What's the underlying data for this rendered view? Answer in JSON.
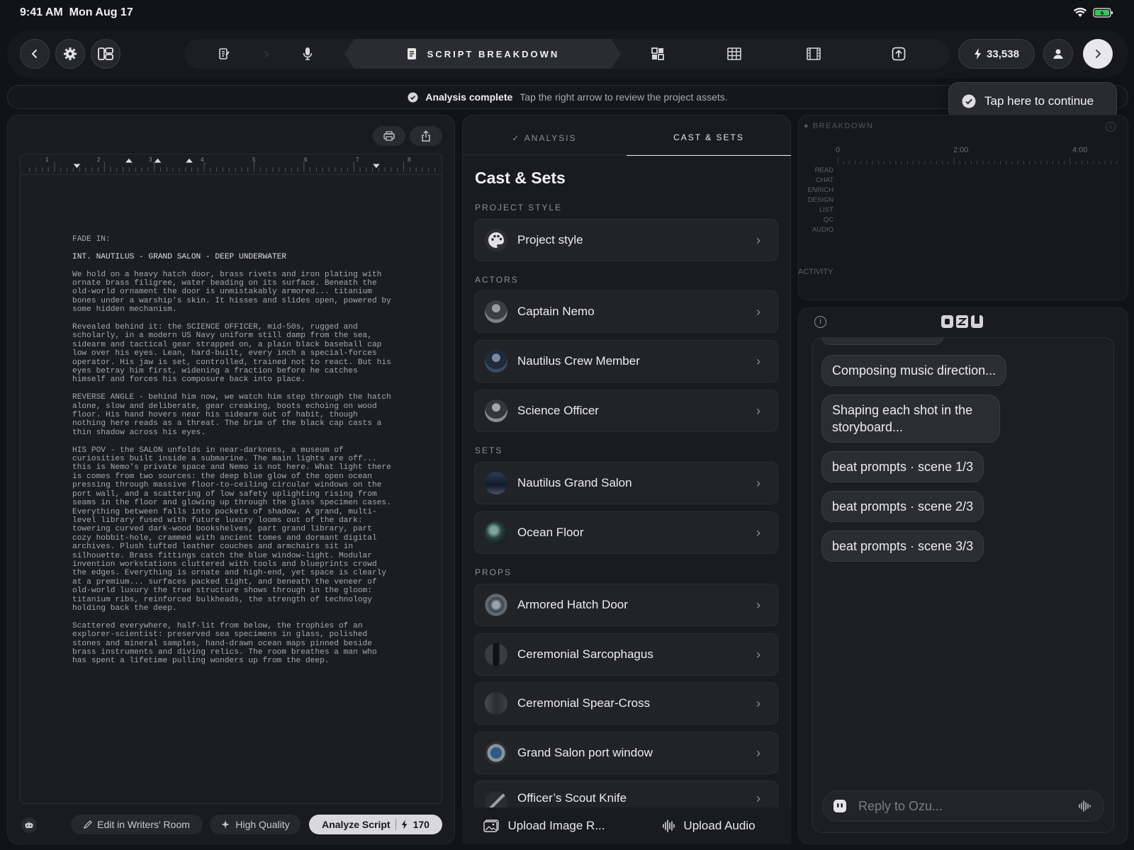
{
  "status": {
    "time": "9:41 AM",
    "date": "Mon Aug 17"
  },
  "toolbar": {
    "active_stage": "SCRIPT BREAKDOWN",
    "credits": "33,538"
  },
  "notice": {
    "title": "Analysis complete",
    "message": "Tap the right arrow to review the project assets."
  },
  "tooltip": {
    "text": "Tap here to continue"
  },
  "script": {
    "paragraphs": [
      "FADE IN:",
      "INT. NAUTILUS - GRAND SALON - DEEP UNDERWATER",
      "We hold on a heavy hatch door, brass rivets and iron plating with ornate brass filigree, water beading on its surface. Beneath the old-world ornament the door is unmistakably armored... titanium bones under a warship's skin. It hisses and slides open, powered by some hidden mechanism.",
      "Revealed behind it: the SCIENCE OFFICER, mid-50s, rugged and scholarly, in a modern US Navy uniform still damp from the sea, sidearm and tactical gear strapped on, a plain black baseball cap low over his eyes. Lean, hard-built, every inch a special-forces operator. His jaw is set, controlled, trained not to react. But his eyes betray him first, widening a fraction before he catches himself and forces his composure back into place.",
      "REVERSE ANGLE - behind him now, we watch him step through the hatch alone, slow and deliberate, gear creaking, boots echoing on wood floor. His hand hovers near his sidearm out of habit, though nothing here reads as a threat. The brim of the black cap casts a thin shadow across his eyes.",
      "HIS POV - the SALON unfolds in near-darkness, a museum of curiosities built inside a submarine. The main lights are off... this is Nemo's private space and Nemo is not here. What light there is comes from two sources: the deep blue glow of the open ocean pressing through massive floor-to-ceiling circular windows on the port wall, and a scattering of low safety uplighting rising from seams in the floor and glowing up through the glass specimen cases. Everything between falls into pockets of shadow. A grand, multi-level library fused with future luxury looms out of the dark: towering curved dark-wood bookshelves, part grand library, part cozy hobbit-hole, crammed with ancient tomes and dormant digital archives. Plush tufted leather couches and armchairs sit in silhouette. Brass fittings catch the blue window-light. Modular invention workstations cluttered with tools and blueprints crowd the edges. Everything is ornate and high-end, yet space is clearly at a premium... surfaces packed tight, and beneath the veneer of old-world luxury the true structure shows through in the gloom: titanium ribs, reinforced bulkheads, the strength of technology holding back the deep.",
      "Scattered everywhere, half-lit from below, the trophies of an explorer-scientist: preserved sea specimens in glass, polished stones and mineral samples, hand-drawn ocean maps pinned beside brass instruments and diving relics. The room breathes a man who has spent a lifetime pulling wonders up from the deep."
    ],
    "ruler_numbers": [
      "1",
      "2",
      "3",
      "4",
      "5",
      "6",
      "7",
      "8"
    ]
  },
  "script_actions": {
    "edit": "Edit in Writers' Room",
    "quality": "High Quality",
    "analyze": "Analyze Script",
    "analyze_cost": "170"
  },
  "cast": {
    "tab_analysis": "ANALYSIS",
    "tab_cast": "CAST & SETS",
    "title": "Cast & Sets",
    "section_style": "PROJECT STYLE",
    "style_item": "Project style",
    "section_actors": "ACTORS",
    "actors": [
      "Captain Nemo",
      "Nautilus Crew Member",
      "Science Officer"
    ],
    "section_sets": "SETS",
    "sets": [
      "Nautilus Grand Salon",
      "Ocean Floor"
    ],
    "section_props": "PROPS",
    "props": [
      "Armored Hatch Door",
      "Ceremonial Sarcophagus",
      "Ceremonial Spear-Cross",
      "Grand Salon port window",
      "Officer’s Scout Knife"
    ],
    "upload_image": "Upload Image R...",
    "upload_audio": "Upload Audio"
  },
  "breakdown": {
    "title": "BREAKDOWN",
    "ticks": [
      "0",
      "2:00",
      "4:00"
    ],
    "tracks": [
      "READ",
      "CHAT",
      "ENRICH",
      "DESIGN",
      "LIST",
      "QC",
      "AUDIO"
    ],
    "activity": "ACTIVITY"
  },
  "chat": {
    "messages": [
      "Composing music direction...",
      "Shaping each shot in the storyboard...",
      "beat prompts · scene 1/3",
      "beat prompts · scene 2/3",
      "beat prompts · scene 3/3"
    ],
    "reply_placeholder": "Reply to Ozu..."
  },
  "colors": {
    "background": "#121316",
    "panel": "#1a1b1e",
    "accent": "#e4e4e6"
  }
}
